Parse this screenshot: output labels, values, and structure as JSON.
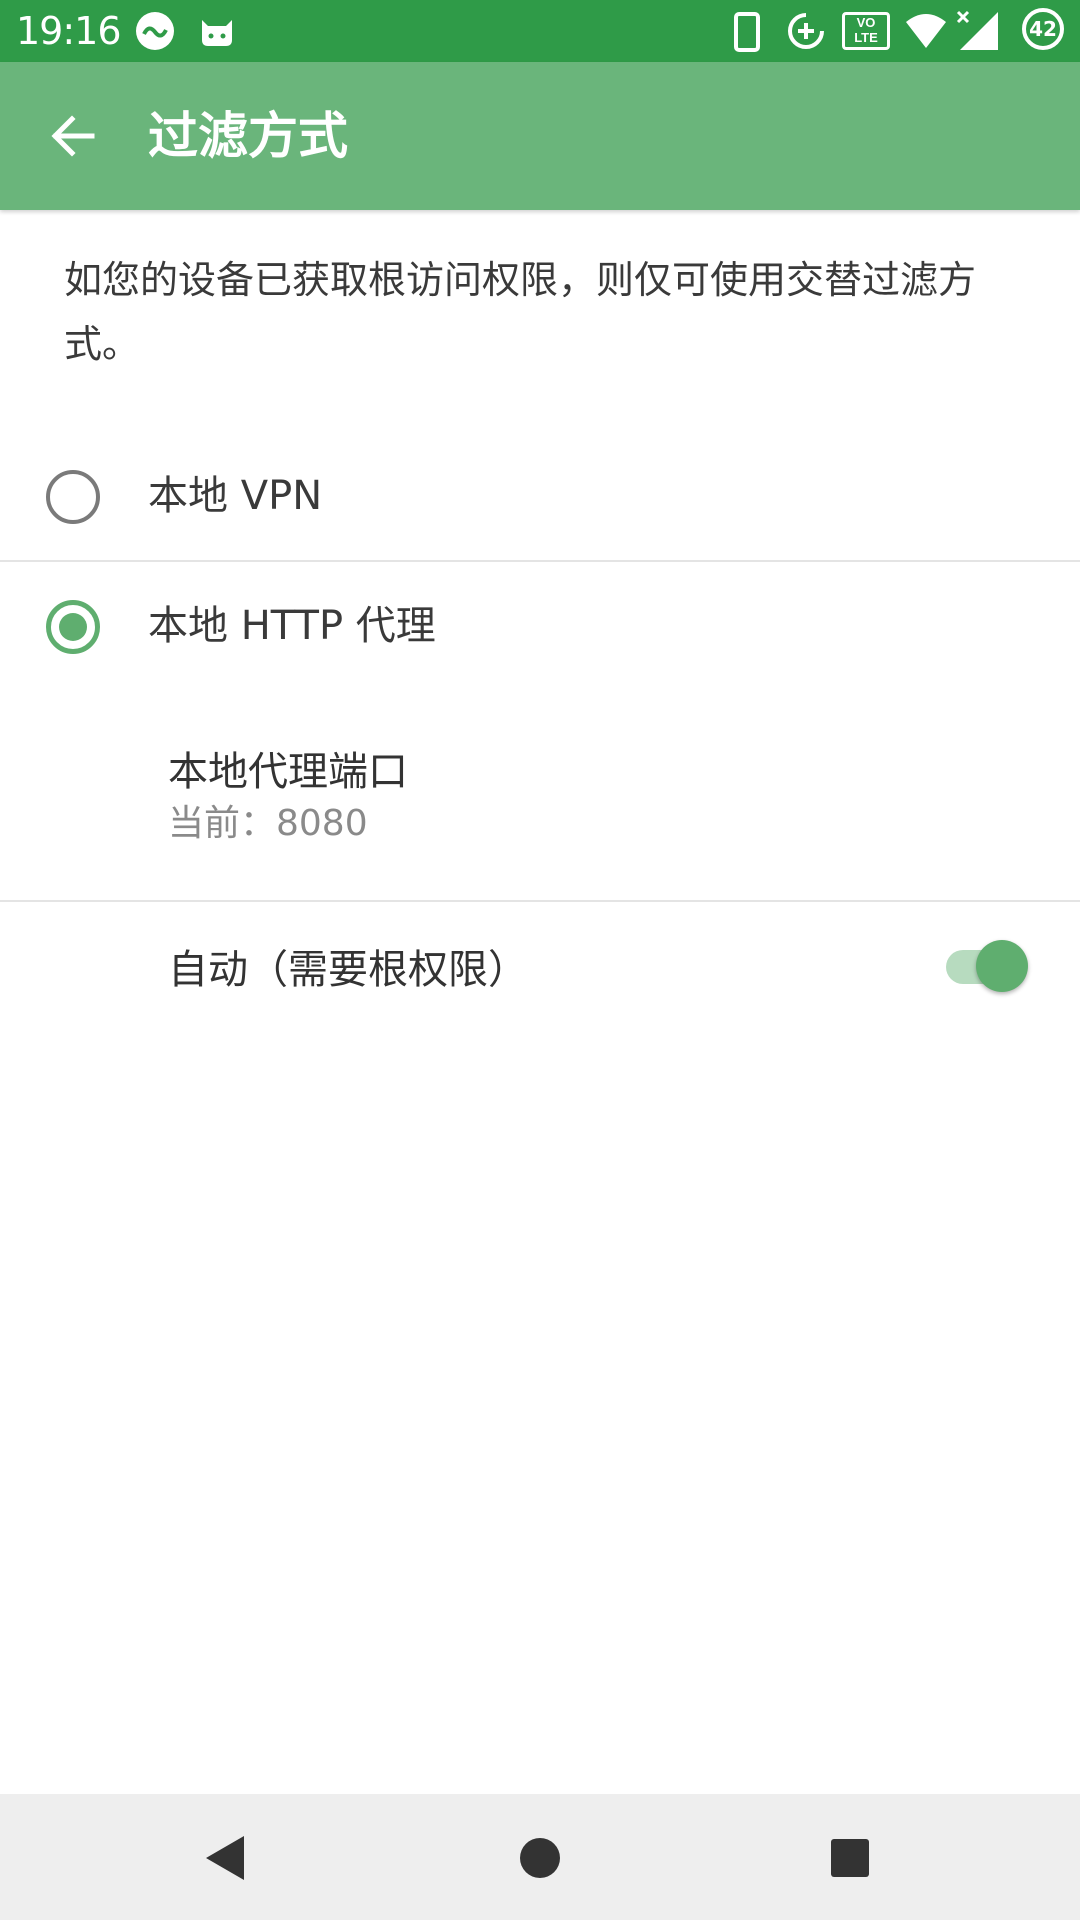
{
  "status_bar": {
    "time": "19:16",
    "battery": "42",
    "icons": [
      "app-notification-icon",
      "cat-app-icon",
      "phone-icon",
      "data-saver-icon",
      "volte-icon",
      "wifi-icon",
      "signal-icon",
      "battery-icon"
    ],
    "volte_top": "VO",
    "volte_bottom": "LTE",
    "color": "#2f9b48"
  },
  "app_bar": {
    "title": "过滤方式",
    "color": "#6ab57b"
  },
  "description": "如您的设备已获取根访问权限，则仅可使用交替过滤方式。",
  "options": [
    {
      "label": "本地 VPN",
      "selected": false
    },
    {
      "label": "本地 HTTP 代理",
      "selected": true
    }
  ],
  "proxy_port": {
    "title": "本地代理端口",
    "summary": "当前：8080"
  },
  "auto_root": {
    "label": "自动（需要根权限）",
    "enabled": true
  },
  "accent_color": "#5fae6f",
  "nav_bar": {
    "icons": [
      "back-triangle-icon",
      "home-circle-icon",
      "recents-square-icon"
    ]
  }
}
